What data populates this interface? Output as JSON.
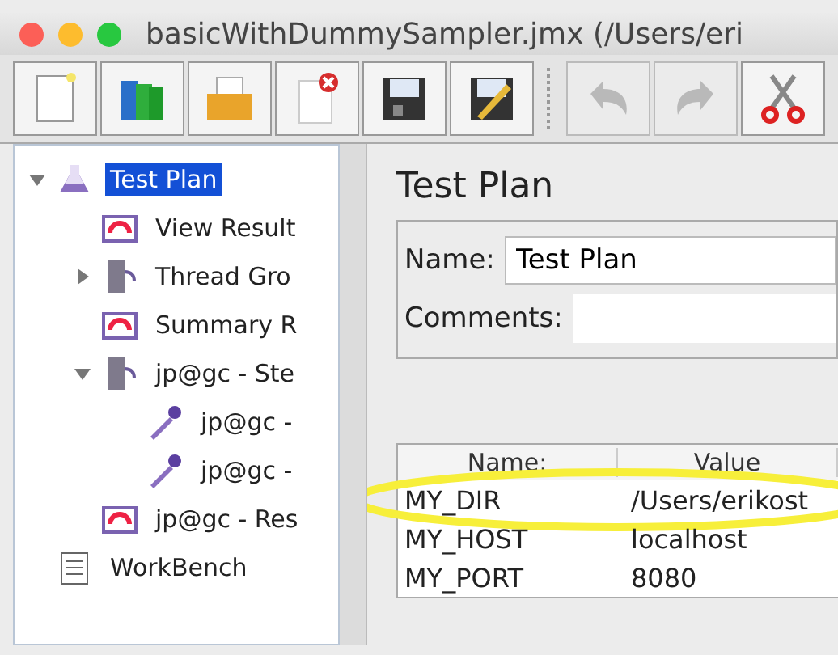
{
  "window": {
    "title": "basicWithDummySampler.jmx (/Users/eri"
  },
  "toolbar": [
    {
      "kind": "new",
      "disabled": false
    },
    {
      "kind": "templates",
      "disabled": false
    },
    {
      "kind": "open",
      "disabled": false
    },
    {
      "kind": "close",
      "disabled": false
    },
    {
      "kind": "save",
      "disabled": false
    },
    {
      "kind": "save-as",
      "disabled": false
    },
    {
      "kind": "separator"
    },
    {
      "kind": "undo",
      "disabled": true
    },
    {
      "kind": "redo",
      "disabled": true
    },
    {
      "kind": "cut",
      "disabled": false
    }
  ],
  "tree": [
    {
      "label": "Test Plan",
      "kind": "plan",
      "selected": true,
      "expanded": true,
      "children": [
        {
          "label": "View Result",
          "kind": "listener",
          "selected": false
        },
        {
          "label": "Thread Gro",
          "kind": "thread-group",
          "selected": false,
          "expanded": false
        },
        {
          "label": "Summary R",
          "kind": "listener",
          "selected": false
        },
        {
          "label": "jp@gc - Ste",
          "kind": "thread-group",
          "selected": false,
          "expanded": true,
          "children": [
            {
              "label": "jp@gc -",
              "kind": "sampler",
              "selected": false
            },
            {
              "label": "jp@gc -",
              "kind": "sampler",
              "selected": false
            }
          ]
        },
        {
          "label": "jp@gc - Res",
          "kind": "listener",
          "selected": false
        }
      ]
    },
    {
      "label": "WorkBench",
      "kind": "workbench",
      "selected": false
    }
  ],
  "panel": {
    "title": "Test Plan",
    "name_label": "Name:",
    "name_value": "Test Plan",
    "comments_label": "Comments:"
  },
  "variables": {
    "columns": [
      "Name:",
      "Value"
    ],
    "rows": [
      {
        "name": "MY_DIR",
        "value": "/Users/erikost",
        "highlighted": true
      },
      {
        "name": "MY_HOST",
        "value": "localhost",
        "highlighted": false
      },
      {
        "name": "MY_PORT",
        "value": "8080",
        "highlighted": false
      }
    ]
  }
}
